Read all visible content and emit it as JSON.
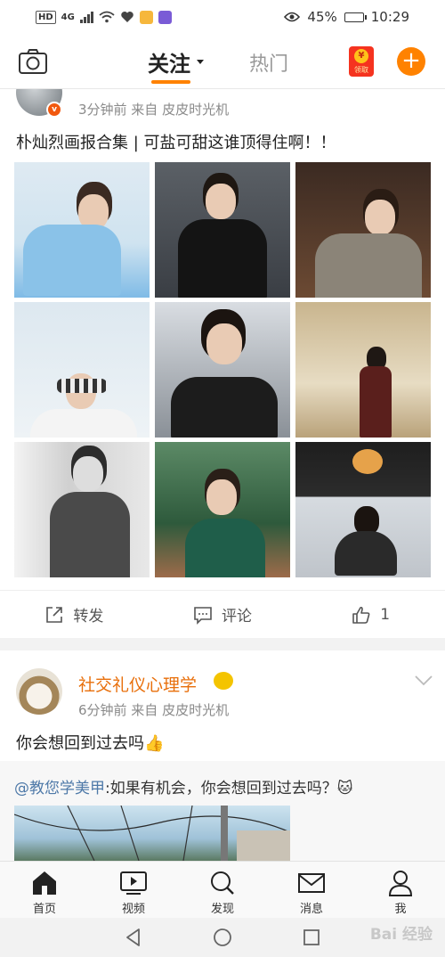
{
  "status_bar": {
    "network_badge": "HD",
    "network_type": "4G",
    "battery_text": "45%",
    "battery_level": 0.45,
    "time": "10:29"
  },
  "header": {
    "tab_follow": "关注",
    "tab_hot": "热门",
    "redpacket_label": "领取",
    "redpacket_coin": "¥",
    "compose_symbol": "+"
  },
  "post1": {
    "vip_mark": "v",
    "meta": "3分钟前  来自 皮皮时光机",
    "text": "朴灿烈画报合集 | 可盐可甜这谁顶得住啊！！",
    "actions": {
      "repost": "转发",
      "comment": "评论",
      "like_count": "1"
    }
  },
  "post2": {
    "user_name": "社交礼仪心理学",
    "meta": "6分钟前  来自 皮皮时光机",
    "text": "你会想回到过去吗👍",
    "repost": {
      "mention": "@教您学美甲",
      "text": ":如果有机会，你会想回到过去吗？🐱"
    }
  },
  "tabbar": {
    "home": "首页",
    "video": "视频",
    "discover": "发现",
    "messages": "消息",
    "me": "我"
  },
  "watermark": "Bai 经验",
  "colors": {
    "accent": "#ff8200",
    "username": "#e86f0b",
    "mention": "#4e79a8"
  }
}
